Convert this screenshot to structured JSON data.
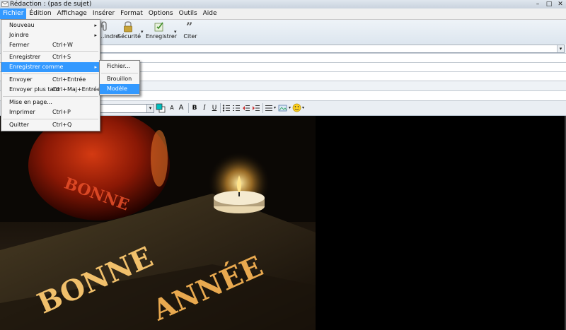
{
  "window": {
    "title": "Rédaction : (pas de sujet)",
    "controls": [
      "–",
      "□",
      "✕"
    ]
  },
  "menubar": {
    "items": [
      {
        "label": "Fichier",
        "active": true
      },
      {
        "label": "Édition"
      },
      {
        "label": "Affichage"
      },
      {
        "label": "Insérer"
      },
      {
        "label": "Format"
      },
      {
        "label": "Options"
      },
      {
        "label": "Outils"
      },
      {
        "label": "Aide"
      }
    ]
  },
  "toolbar": {
    "items": [
      {
        "label": "...indre",
        "icon": "paperclip-icon"
      },
      {
        "label": "Sécurité",
        "icon": "lock-icon"
      },
      {
        "label": "Enregistrer",
        "icon": "save-icon"
      },
      {
        "label": "Citer",
        "icon": "quote-icon"
      }
    ]
  },
  "file_menu": {
    "items": [
      {
        "label": "Nouveau",
        "shortcut": "",
        "submenu": true
      },
      {
        "label": "Joindre",
        "shortcut": "",
        "submenu": true
      },
      {
        "label": "Fermer",
        "shortcut": "Ctrl+W"
      },
      {
        "label": "Enregistrer",
        "shortcut": "Ctrl+S"
      },
      {
        "label": "Enregistrer comme",
        "shortcut": "",
        "submenu": true,
        "highlighted": true
      },
      {
        "label": "Envoyer",
        "shortcut": "Ctrl+Entrée"
      },
      {
        "label": "Envoyer plus tard",
        "shortcut": "Ctrl+Maj+Entrée"
      },
      {
        "label": "Mise en page...",
        "shortcut": ""
      },
      {
        "label": "Imprimer",
        "shortcut": "Ctrl+P"
      },
      {
        "label": "Quitter",
        "shortcut": "Ctrl+Q"
      }
    ]
  },
  "save_as_submenu": {
    "items": [
      {
        "label": "Fichier..."
      },
      {
        "label": "Brouillon"
      },
      {
        "label": "Modèle",
        "highlighted": true
      }
    ]
  },
  "format_toolbar": {
    "buttons": [
      "A",
      "A",
      "B",
      "I",
      "U"
    ]
  },
  "editor": {
    "image_caption_word1": "BONNE",
    "image_caption_word2": "ANNÉE"
  },
  "colors": {
    "menu_highlight": "#3399ff",
    "editor_background": "#000000"
  }
}
